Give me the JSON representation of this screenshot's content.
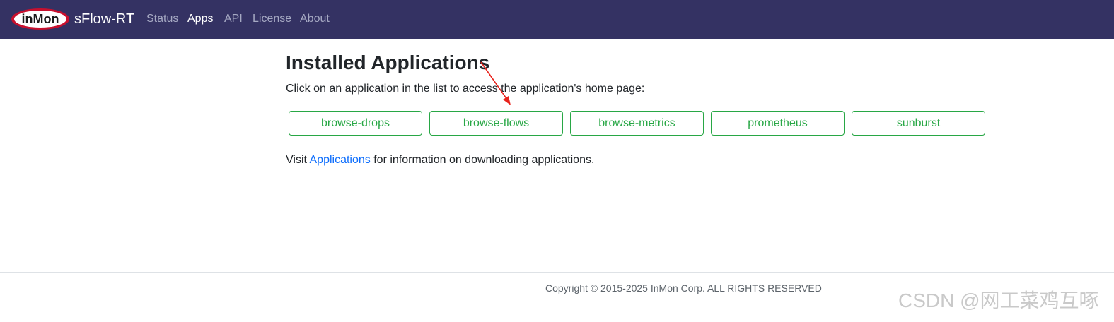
{
  "navbar": {
    "logo_text": "inMon",
    "brand": "sFlow-RT",
    "items": [
      {
        "label": "Status",
        "active": false
      },
      {
        "label": "Apps",
        "active": true
      },
      {
        "label": "API",
        "active": false
      },
      {
        "label": "License",
        "active": false
      },
      {
        "label": "About",
        "active": false
      }
    ]
  },
  "main": {
    "title": "Installed Applications",
    "intro": "Click on an application in the list to access the application's home page:",
    "apps": [
      "browse-drops",
      "browse-flows",
      "browse-metrics",
      "prometheus",
      "sunburst"
    ],
    "visit_prefix": "Visit ",
    "visit_link": "Applications",
    "visit_suffix": " for information on downloading applications."
  },
  "footer": {
    "copyright": "Copyright © 2015-2025 InMon Corp. ALL RIGHTS RESERVED"
  },
  "watermark": "CSDN @网工菜鸡互啄",
  "colors": {
    "navbar_bg": "#343263",
    "app_button": "#28a745",
    "link": "#0d6efd",
    "annotation_arrow": "#e8231c"
  }
}
